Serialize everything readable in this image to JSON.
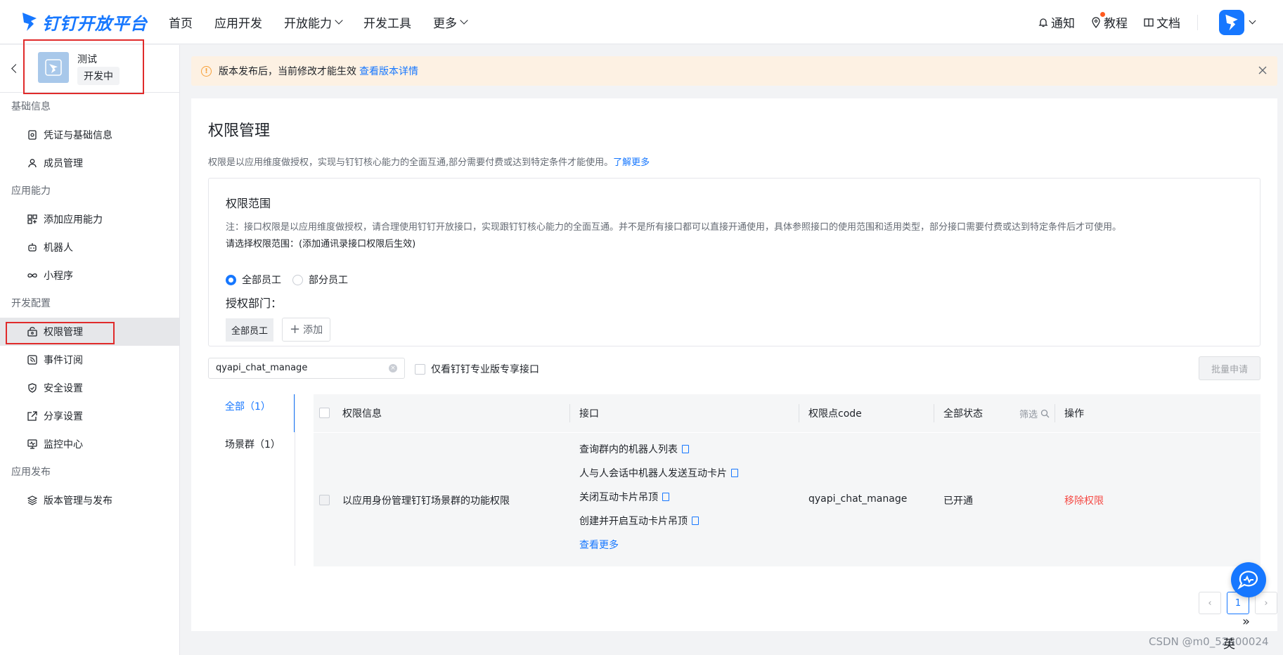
{
  "topbar": {
    "logo_text": "钉钉开放平台",
    "nav": [
      "首页",
      "应用开发",
      "开放能力",
      "开发工具",
      "更多"
    ],
    "notify_label": "通知",
    "tutorial_label": "教程",
    "docs_label": "文档"
  },
  "sidebar": {
    "app_name": "测试",
    "app_status": "开发中",
    "sections": [
      {
        "title": "基础信息",
        "items": [
          "凭证与基础信息",
          "成员管理"
        ]
      },
      {
        "title": "应用能力",
        "items": [
          "添加应用能力",
          "机器人",
          "小程序"
        ]
      },
      {
        "title": "开发配置",
        "items": [
          "权限管理",
          "事件订阅",
          "安全设置",
          "分享设置",
          "监控中心"
        ]
      },
      {
        "title": "应用发布",
        "items": [
          "版本管理与发布"
        ]
      }
    ]
  },
  "notice": {
    "text": "版本发布后，当前修改才能生效",
    "link": "查看版本详情"
  },
  "page": {
    "title": "权限管理",
    "desc": "权限是以应用维度做授权，实现与钉钉核心能力的全面互通,部分需要付费或达到特定条件才能使用。",
    "desc_link": "了解更多"
  },
  "scope": {
    "title": "权限范围",
    "note": "注：接口权限是以应用维度做授权，请合理使用钉钉开放接口，实现跟钉钉核心能力的全面互通。并不是所有接口都可以直接开通使用，具体参照接口的使用范围和适用类型，部分接口需要付费或达到特定条件后才可使用。",
    "select_hint": "请选择权限范围：(添加通讯录接口权限后生效)",
    "radio_all": "全部员工",
    "radio_part": "部分员工",
    "dept_label": "授权部门：",
    "dept_tag": "全部员工",
    "add_label": "添加"
  },
  "filter": {
    "search_value": "qyapi_chat_manage",
    "checkbox_label": "仅看钉钉专业版专享接口",
    "batch_label": "批量申请"
  },
  "tabs": [
    "全部（1）",
    "场景群（1）"
  ],
  "table": {
    "headers": [
      "权限信息",
      "接口",
      "权限点code",
      "全部状态",
      "筛选",
      "操作"
    ],
    "rows": [
      {
        "info": "以应用身份管理钉钉场景群的功能权限",
        "apis": [
          "查询群内的机器人列表",
          "人与人会话中机器人发送互动卡片",
          "关闭互动卡片吊顶",
          "创建并开启互动卡片吊顶"
        ],
        "more": "查看更多",
        "code": "qyapi_chat_manage",
        "status": "已开通",
        "action": "移除权限"
      }
    ]
  },
  "pager": {
    "current": "1"
  },
  "watermark": "CSDN @m0_52600024",
  "ime": "英"
}
